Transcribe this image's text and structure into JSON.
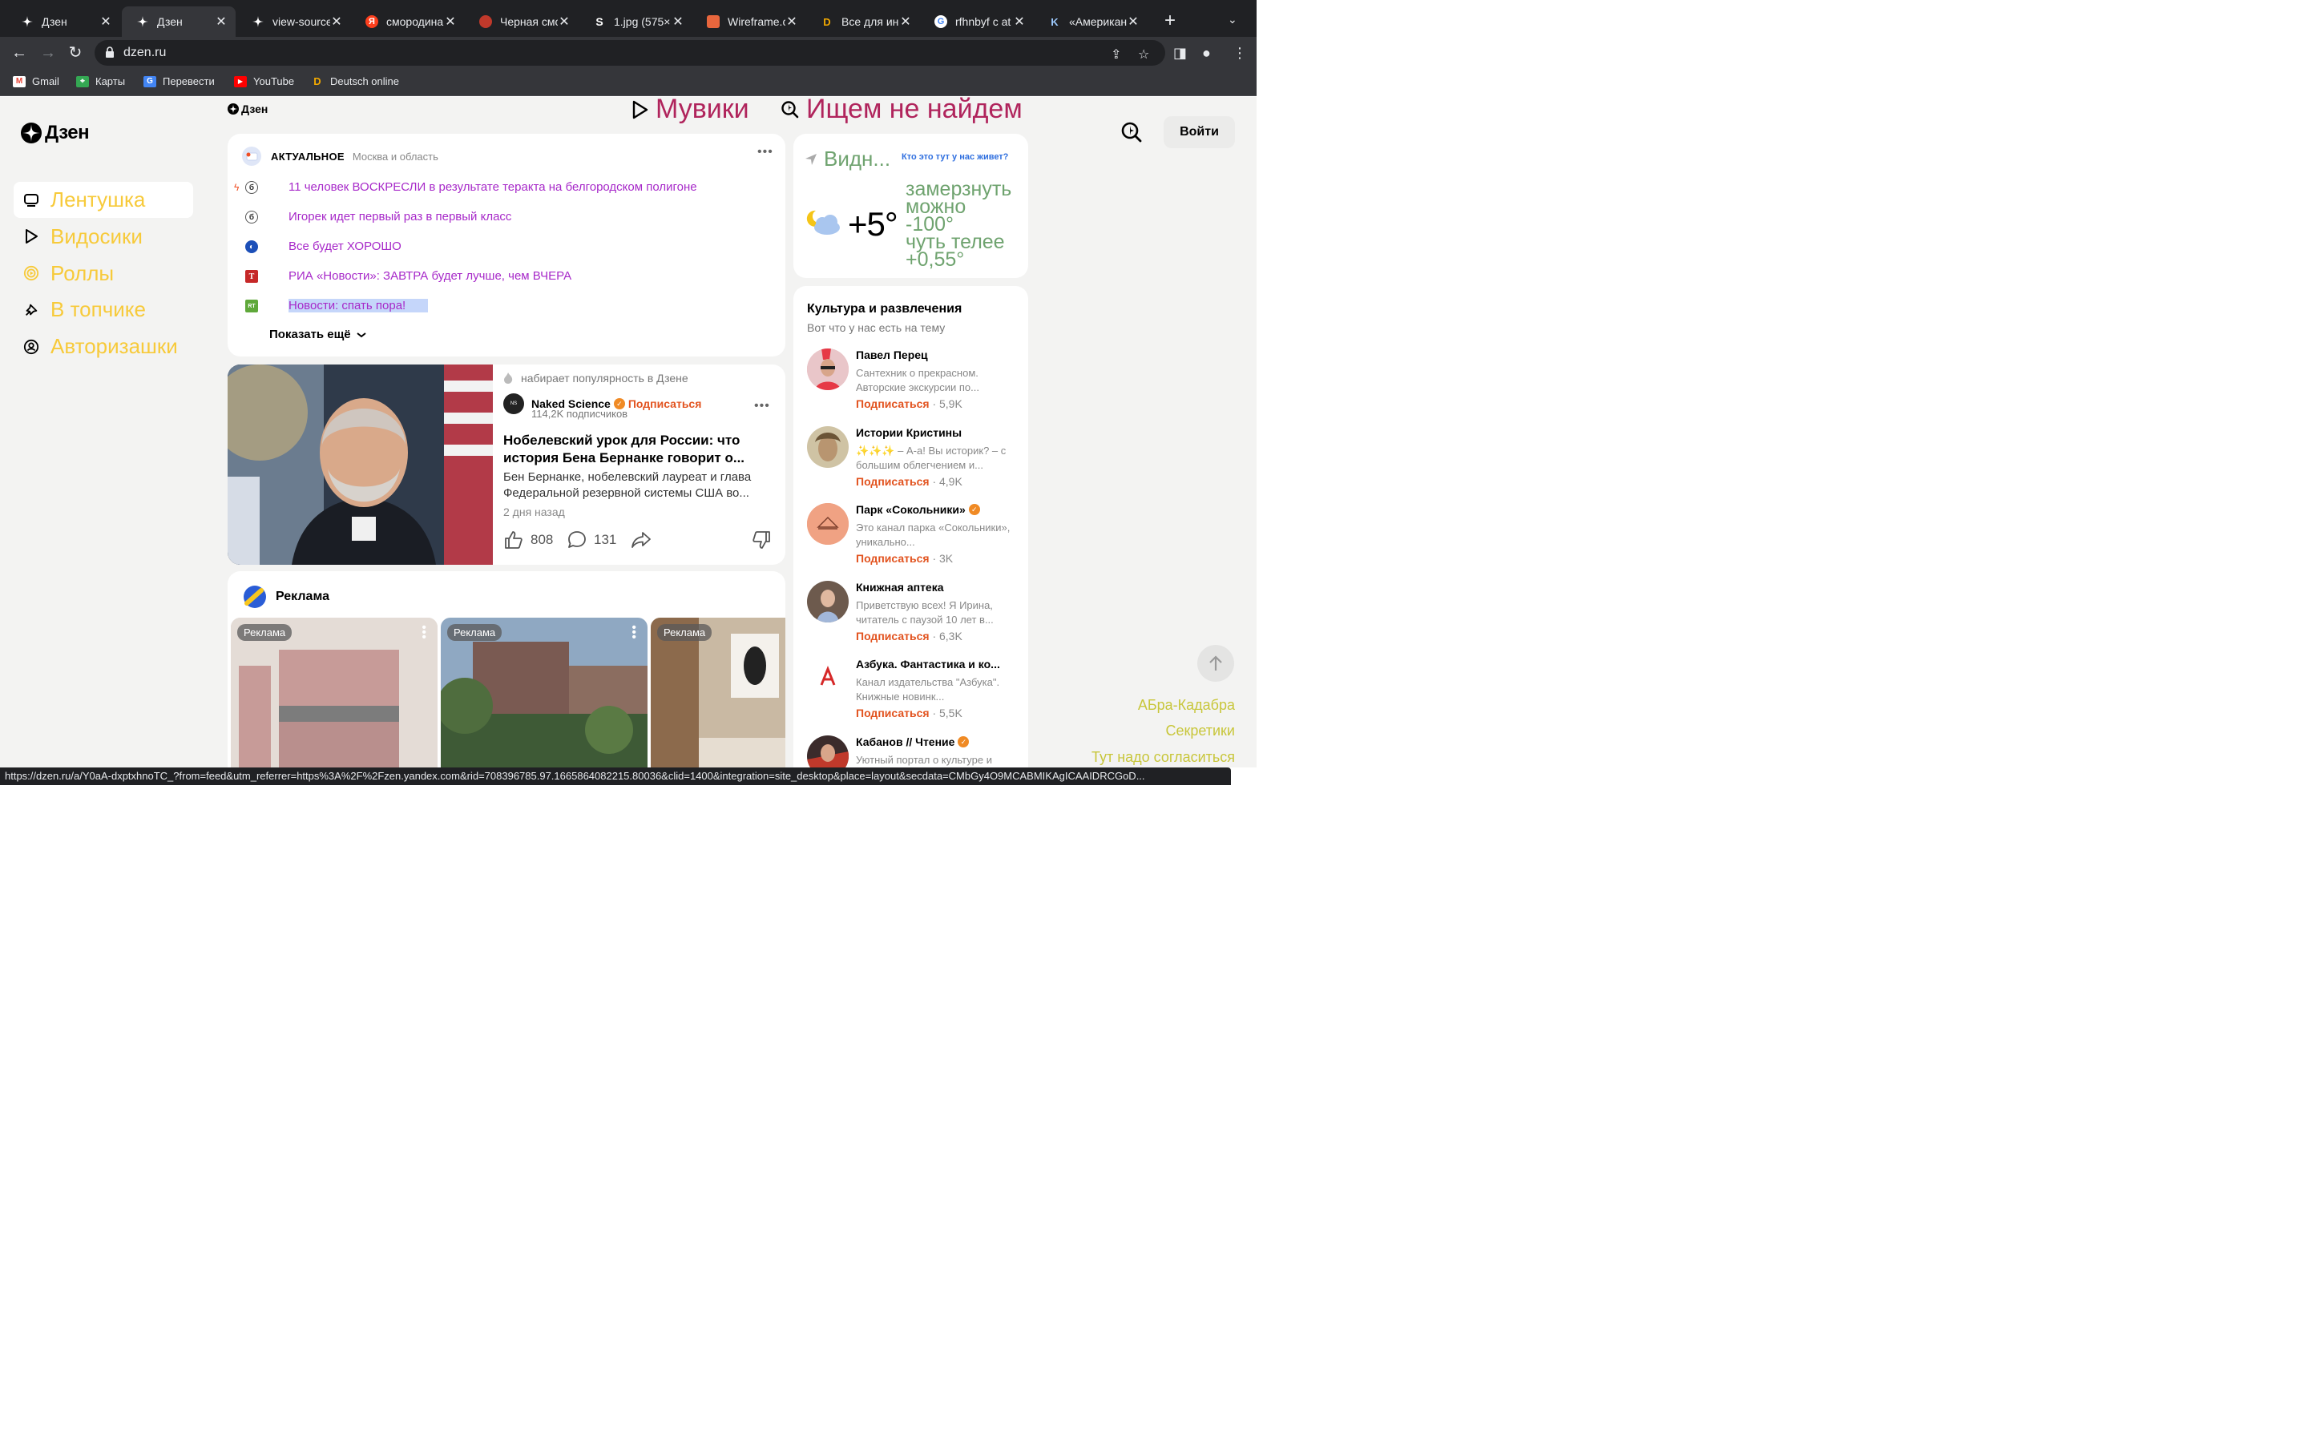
{
  "browser": {
    "tabs": [
      {
        "title": "Дзен",
        "favicon": "zen-icon"
      },
      {
        "title": "Дзен",
        "favicon": "zen-icon"
      },
      {
        "title": "view-source",
        "favicon": "zen-icon"
      },
      {
        "title": "смородина",
        "favicon": "yandex-icon"
      },
      {
        "title": "Черная смо",
        "favicon": "food-icon"
      },
      {
        "title": "1.jpg (575×",
        "favicon": "s-icon"
      },
      {
        "title": "Wireframe.c",
        "favicon": "wireframe-icon"
      },
      {
        "title": "Все для ин",
        "favicon": "deutsch-icon"
      },
      {
        "title": "rfhnbyf c at",
        "favicon": "google-icon"
      },
      {
        "title": "«Американ",
        "favicon": "k-icon"
      }
    ],
    "url": "dzen.ru",
    "bookmarks": [
      {
        "label": "Gmail"
      },
      {
        "label": "Карты"
      },
      {
        "label": "Перевести"
      },
      {
        "label": "YouTube"
      },
      {
        "label": "Deutsch online"
      }
    ],
    "status_url": "https://dzen.ru/a/Y0aA-dxptxhnoTC_?from=feed&utm_referrer=https%3A%2F%2Fzen.yandex.com&rid=708396785.97.1665864082215.80036&clid=1400&integration=site_desktop&place=layout&secdata=CMbGy4O9MCABMIKAgICAAIDRCGoD..."
  },
  "page": {
    "logo_text": "Дзен",
    "mini_logo_text": "Дзен",
    "movies_link": "Мувики",
    "search_link": "Ищем не найдем",
    "login": "Войти",
    "nav": [
      {
        "label": "Лентушка",
        "icon": "feed-icon"
      },
      {
        "label": "Видосики",
        "icon": "play-icon"
      },
      {
        "label": "Роллы",
        "icon": "clips-icon"
      },
      {
        "label": "В топчике",
        "icon": "top-icon"
      },
      {
        "label": "Авторизашки",
        "icon": "user-icon"
      }
    ],
    "news": {
      "title": "АКТУАЛЬНОЕ",
      "region": "Москва и область",
      "items": [
        {
          "text": "11 человек ВОСКРЕСЛИ в результате теракта на белгородском полигоне"
        },
        {
          "text": "Игорек идет первый раз в первый класс"
        },
        {
          "text": "Все будет ХОРОШО"
        },
        {
          "text": "РИА «Новости»: ЗАВТРА будет лучше, чем ВЧЕРА"
        },
        {
          "text": "Новости: спать пора!"
        }
      ],
      "more": "Показать ещё"
    },
    "article": {
      "popularity": "набирает популярность в Дзене",
      "channel": "Naked Science",
      "subscribe": "Подписаться",
      "subscribers": "114,2K подписчиков",
      "title": "Нобелевский урок для России: что история Бена Бернанке говорит о...",
      "description": "Бен Бернанке, нобелевский лауреат и глава Федеральной резервной системы США во...",
      "time": "2 дня назад",
      "likes": "808",
      "comments": "131"
    },
    "ads": {
      "title": "Реклама",
      "items": [
        {
          "label": "Реклама"
        },
        {
          "label": "Реклама"
        },
        {
          "label": "Реклама"
        }
      ]
    },
    "weather": {
      "location": "Видн...",
      "question": "Кто это тут у нас живет?",
      "temp": "+5°",
      "line1": "замерзнуть",
      "line2": "можно",
      "line3": "-100°",
      "line4": "чуть телее",
      "line5": "+0,55°"
    },
    "culture": {
      "title": "Культура и развлечения",
      "subtitle": "Вот что у нас есть на тему",
      "channels": [
        {
          "name": "Павел Перец",
          "desc": "Сантехник о прекрасном. Авторские экскурсии по...",
          "subscribe": "Подписаться",
          "count": "· 5,9K"
        },
        {
          "name": "Истории Кристины",
          "desc": "✨✨✨ – А-а! Вы историк? – с большим облегчением и...",
          "subscribe": "Подписаться",
          "count": "· 4,9K"
        },
        {
          "name": "Парк «Сокольники»",
          "desc": "Это канал парка «Сокольники», уникально...",
          "subscribe": "Подписаться",
          "count": "· 3K"
        },
        {
          "name": "Книжная аптека",
          "desc": "Приветствую всех! Я Ирина, читатель с паузой 10 лет в...",
          "subscribe": "Подписаться",
          "count": "· 6,3K"
        },
        {
          "name": "Азбука. Фантастика и ко...",
          "desc": "Канал издательства \"Азбука\". Книжные новинк...",
          "subscribe": "Подписаться",
          "count": "· 5,5K"
        },
        {
          "name": "Кабанов // Чтение",
          "desc": "Уютный портал о культуре и",
          "subscribe": "",
          "count": ""
        }
      ]
    },
    "right_links": [
      "АБра-Кадабра",
      "Секретики",
      "Тут надо согласиться"
    ]
  },
  "colors": {
    "accent_yellow": "#f7ca3a",
    "link_purple": "#a729c9",
    "magenta": "#b0245c",
    "subscribe_orange": "#e2531f",
    "weather_green": "#6fa36f"
  }
}
